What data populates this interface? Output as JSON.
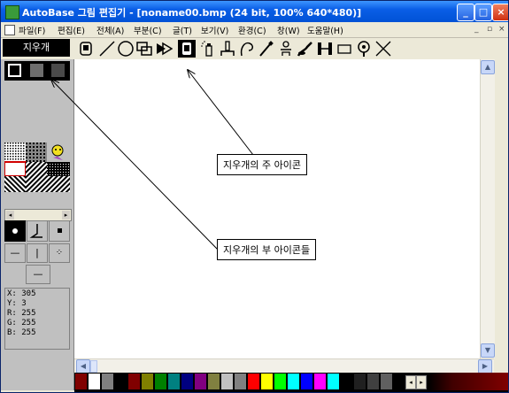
{
  "window": {
    "title": "AutoBase 그림 편집기 - [noname00.bmp (24 bit, 100% 640*480)]",
    "controls": [
      "_",
      "□",
      "×"
    ]
  },
  "menu": {
    "items": [
      "파일(F)",
      "편집(E)",
      "전체(A)",
      "부분(C)",
      "글(T)",
      "보기(V)",
      "환경(C)",
      "창(W)",
      "도움말(H)"
    ],
    "mdi_controls": [
      "_",
      "▫",
      "×"
    ]
  },
  "toolbar": {
    "current_tool": "지우개",
    "tools": [
      "tool-icon",
      "line-icon",
      "circle-icon",
      "rectangle-icon",
      "fill-icon",
      "eraser-icon",
      "spray-icon",
      "stamp-icon",
      "curve-icon",
      "pen-icon",
      "text-icon",
      "brush-icon",
      "measure-icon",
      "select-icon",
      "zoom-icon",
      "cross-icon"
    ]
  },
  "status": {
    "x": "X: 305",
    "y": "Y: 3",
    "r": "R: 255",
    "g": "G: 255",
    "b": "B: 255"
  },
  "annotations": {
    "main_icon": "지우개의 주 아이콘",
    "sub_icons": "지우개의 부 아이콘들"
  },
  "palette": {
    "colors": [
      "#800000",
      "#ffffff",
      "#808080",
      "#000000",
      "#800000",
      "#808000",
      "#008000",
      "#008080",
      "#000080",
      "#800080",
      "#808040",
      "#c0c0c0",
      "#808080",
      "#ff0000",
      "#ffff00",
      "#00ff00",
      "#00ffff",
      "#0000ff",
      "#ff00ff",
      "#00ffff",
      "#000000",
      "#202020",
      "#404040",
      "#606060"
    ]
  }
}
